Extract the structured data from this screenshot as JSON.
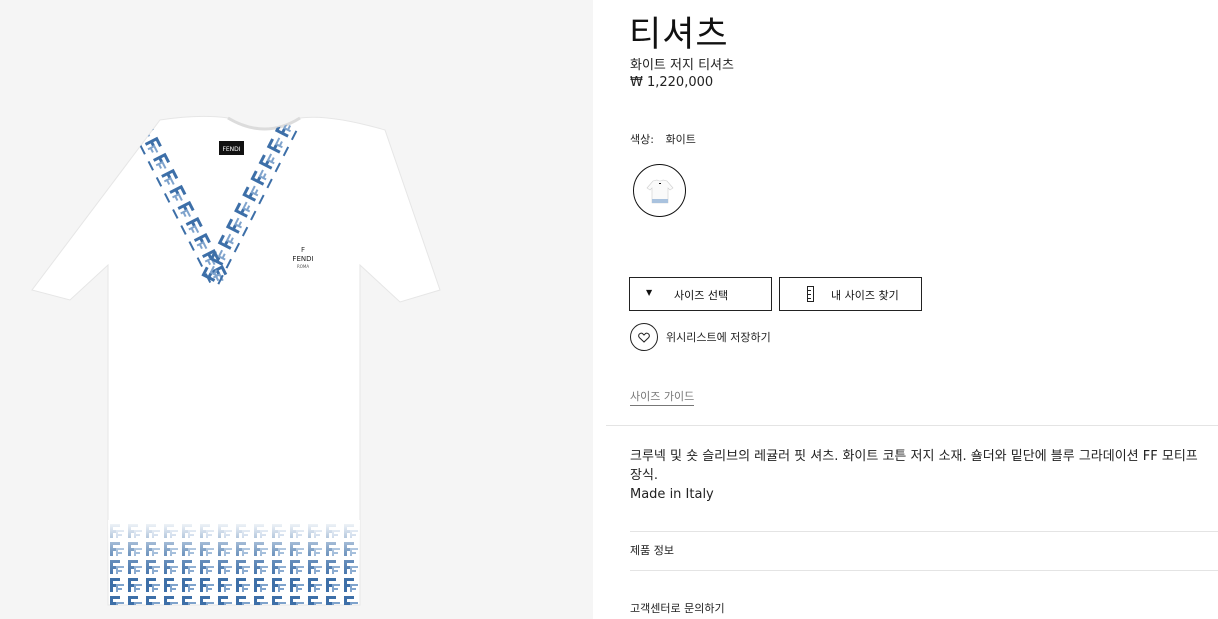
{
  "product": {
    "title": "티셔츠",
    "subtitle": "화이트 저지 티셔츠",
    "price": "₩ 1,220,000",
    "image_alt": "FENDI",
    "chest_logo_brand": "FENDI",
    "chest_logo_sub": "ROMA"
  },
  "color": {
    "label": "색상:",
    "value": "화이트",
    "swatches": [
      {
        "name": "화이트",
        "selected": true
      }
    ]
  },
  "actions": {
    "size_select_label": "사이즈 선택",
    "size_select_icon": "chevron-down-icon",
    "find_size_label": "내 사이즈 찾기",
    "find_size_icon": "ruler-icon",
    "wishlist_label": "위시리스트에 저장하기",
    "wishlist_icon": "heart-icon",
    "size_guide_label": "사이즈 가이드"
  },
  "description": {
    "text": "크루넥 및 숏 슬리브의 레귤러 핏 셔츠. 화이트 코튼 저지 소재. 숄더와 밑단에 블루 그라데이션 FF 모티프 장식.",
    "origin": "Made in Italy"
  },
  "accordion": [
    {
      "label": "제품 정보"
    },
    {
      "label": "고객센터로 문의하기"
    }
  ],
  "colors": {
    "gallery_bg": "#f5f5f5",
    "accent_blue": "#3d6fa8",
    "text": "#1a1a1a",
    "divider": "#e4e4e4"
  }
}
